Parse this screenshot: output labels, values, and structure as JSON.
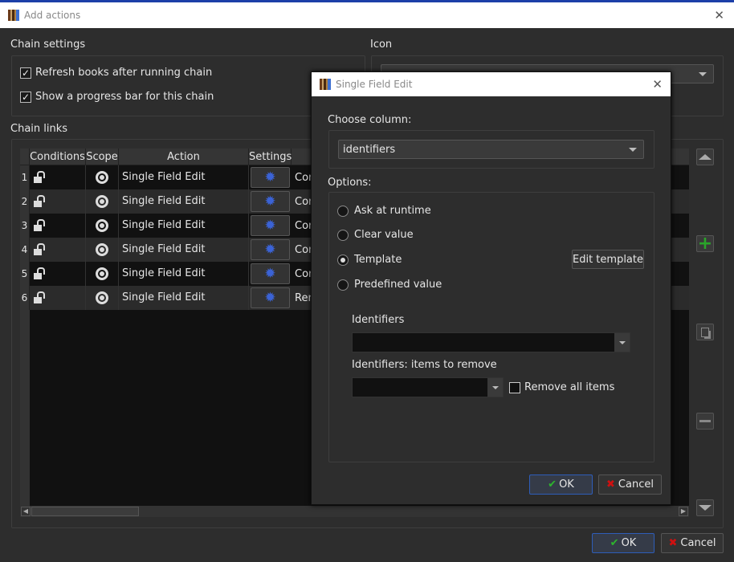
{
  "window": {
    "title": "Add actions",
    "close": "✕"
  },
  "chain_settings": {
    "label": "Chain settings",
    "refresh": "Refresh books after running chain",
    "progress": "Show a progress bar for this chain",
    "refresh_checked": true,
    "progress_checked": true
  },
  "icon": {
    "label": "Icon"
  },
  "chain_links": {
    "label": "Chain links",
    "headers": [
      "Conditions",
      "Scope",
      "Action",
      "Settings"
    ],
    "rows": [
      {
        "n": "1",
        "action": "Single Field Edit",
        "extra": "Cor"
      },
      {
        "n": "2",
        "action": "Single Field Edit",
        "extra": "Cor"
      },
      {
        "n": "3",
        "action": "Single Field Edit",
        "extra": "Cor"
      },
      {
        "n": "4",
        "action": "Single Field Edit",
        "extra": "Cor"
      },
      {
        "n": "5",
        "action": "Single Field Edit",
        "extra": "Cor"
      },
      {
        "n": "6",
        "action": "Single Field Edit",
        "extra": "Rer"
      }
    ]
  },
  "footer": {
    "ok": "OK",
    "cancel": "Cancel"
  },
  "dialog": {
    "title": "Single Field Edit",
    "close": "✕",
    "choose_column": "Choose column:",
    "column_value": "identifiers",
    "options_label": "Options:",
    "options": [
      "Ask at runtime",
      "Clear value",
      "Template",
      "Predefined value"
    ],
    "selected": "Template",
    "edit_template": "Edit template",
    "identifiers_label": "Identifiers",
    "remove_label": "Identifiers: items to remove",
    "remove_all": "Remove all items",
    "remove_all_checked": false,
    "ok": "OK",
    "cancel": "Cancel"
  },
  "colors": {
    "accent": "#2e5db8",
    "ok_check": "#2db52d",
    "cancel_x": "#d01010",
    "gear": "#3b63d6",
    "add": "#2aa52a"
  }
}
